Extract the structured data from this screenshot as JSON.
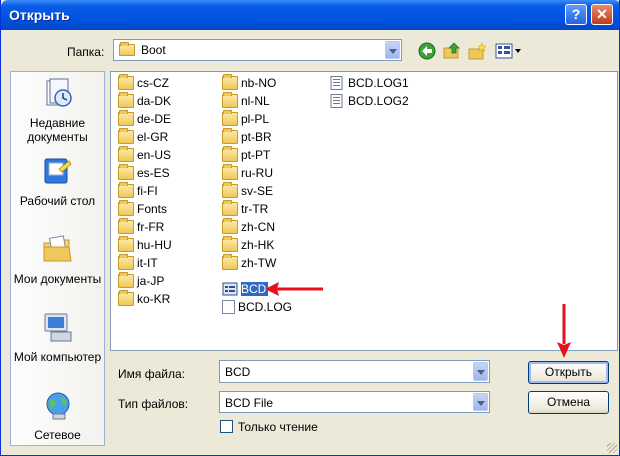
{
  "window": {
    "title": "Открыть",
    "help_glyph": "?",
    "close_glyph": "✕"
  },
  "folder_bar": {
    "label": "Папка:",
    "current": "Boot"
  },
  "places": [
    {
      "label": "Недавние документы",
      "icon": "recent-documents-icon"
    },
    {
      "label": "Рабочий стол",
      "icon": "desktop-icon"
    },
    {
      "label": "Мои документы",
      "icon": "my-documents-icon"
    },
    {
      "label": "Мой компьютер",
      "icon": "my-computer-icon"
    },
    {
      "label": "Сетевое",
      "icon": "network-icon"
    }
  ],
  "files": {
    "col1": [
      "cs-CZ",
      "da-DK",
      "de-DE",
      "el-GR",
      "en-US",
      "es-ES",
      "fi-FI",
      "Fonts",
      "fr-FR",
      "hu-HU",
      "it-IT",
      "ja-JP",
      "ko-KR"
    ],
    "col2": [
      "nb-NO",
      "nl-NL",
      "pl-PL",
      "pt-BR",
      "pt-PT",
      "ru-RU",
      "sv-SE",
      "tr-TR",
      "zh-CN",
      "zh-HK",
      "zh-TW"
    ],
    "col2_files": [
      {
        "name": "BCD",
        "selected": true
      },
      {
        "name": "BCD.LOG",
        "selected": false
      }
    ],
    "col3_files": [
      "BCD.LOG1",
      "BCD.LOG2"
    ]
  },
  "form": {
    "filename_label": "Имя файла:",
    "filename_value": "BCD",
    "filetype_label": "Тип файлов:",
    "filetype_value": "BCD File",
    "readonly_label": "Только чтение",
    "readonly_checked": false
  },
  "buttons": {
    "open": "Открыть",
    "cancel": "Отмена"
  },
  "colors": {
    "title_bar": "#0054e3",
    "selection": "#316ac5",
    "annotation_arrow": "#e8101c"
  }
}
